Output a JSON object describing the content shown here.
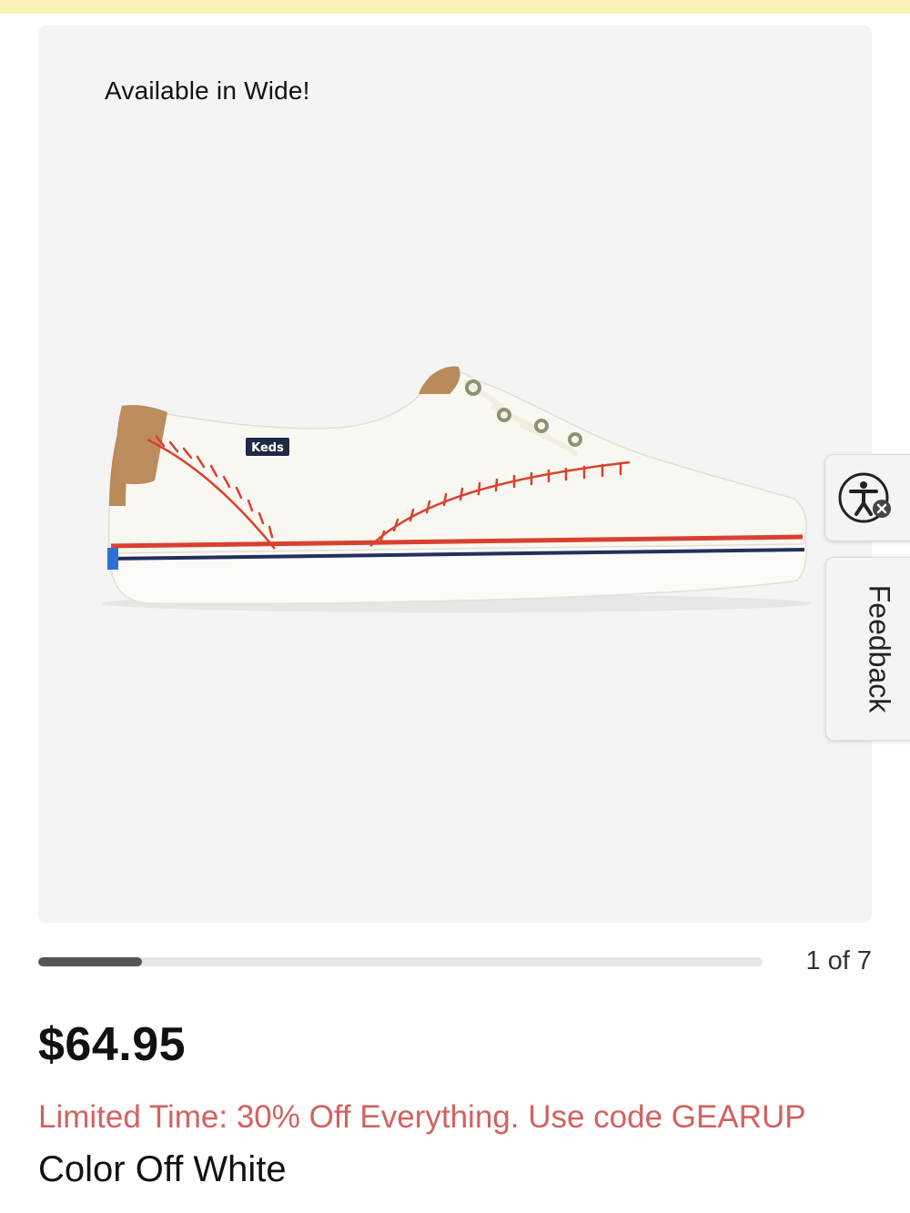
{
  "gallery": {
    "badge": "Available in Wide!",
    "image_alt": "Keds off white baseball stitch sneaker",
    "logo_text": "Keds",
    "progress": {
      "current": 1,
      "total": 7,
      "fraction": 0.143
    },
    "counter_text": "1 of 7"
  },
  "product": {
    "price": "$64.95",
    "promo": "Limited Time: 30% Off Everything. Use code GEARUP",
    "color_line": "Color Off White"
  },
  "widgets": {
    "accessibility_icon": "accessibility-icon",
    "feedback_label": "Feedback"
  },
  "colors": {
    "top_strip": "#fbf1b5",
    "gallery_bg": "#f4f4f4",
    "promo_text": "#d2625e",
    "stitch_red": "#d8412f",
    "stripe_navy": "#23305e"
  }
}
